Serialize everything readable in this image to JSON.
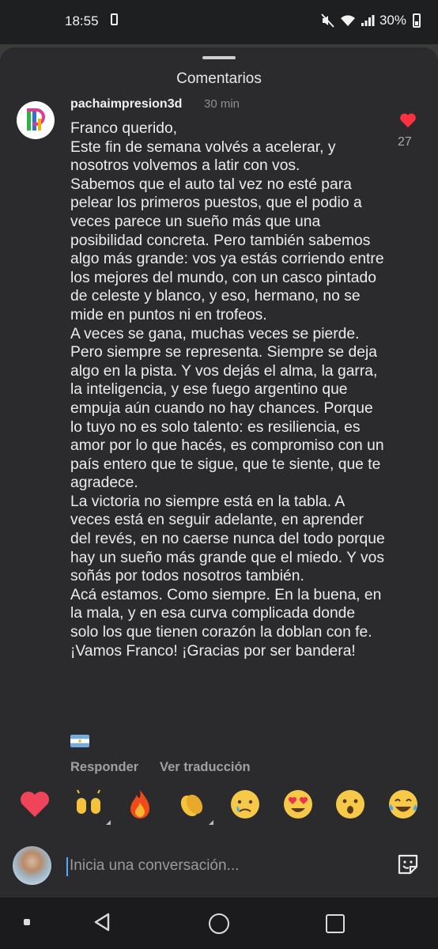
{
  "status_bar": {
    "time": "18:55",
    "battery": "30%",
    "icons": [
      "sim-card-icon",
      "mute-icon",
      "wifi-icon",
      "signal-icon",
      "battery-icon"
    ]
  },
  "sheet": {
    "title": "Comentarios"
  },
  "comment": {
    "username": "pachaimpresion3d",
    "time_ago": "30 min",
    "text": "Franco querido,\nEste fin de semana volvés a acelerar, y nosotros volvemos a latir con vos.\nSabemos que el auto tal vez no esté para pelear los primeros puestos, que el podio a veces parece un sueño más que una posibilidad concreta. Pero también sabemos algo más grande: vos ya estás corriendo entre los mejores del mundo, con un casco pintado de celeste y blanco, y eso, hermano, no se mide en puntos ni en trofeos.\nA veces se gana, muchas veces se pierde. Pero siempre se representa. Siempre se deja algo en la pista. Y vos dejás el alma, la garra, la inteligencia, y ese fuego argentino que empuja aún cuando no hay chances. Porque lo tuyo no es solo talento: es resiliencia, es amor por lo que hacés, es compromiso con un país entero que te sigue, que te siente, que te agradece.\nLa victoria no siempre está en la tabla. A veces está en seguir adelante, en aprender del revés, en no caerse nunca del todo porque hay un sueño más grande que el miedo. Y vos soñás por todos nosotros también.\nAcá estamos. Como siempre. En la buena, en la mala, y en esa curva complicada donde solo los que tienen corazón la doblan con fe.\n¡Vamos Franco! ¡Gracias por ser bandera!",
    "flag_emoji": "argentina-flag-icon",
    "likes": "27",
    "reply_label": "Responder",
    "translate_label": "Ver traducción"
  },
  "reactions": [
    {
      "name": "red-heart-emoji"
    },
    {
      "name": "raising-hands-emoji"
    },
    {
      "name": "fire-emoji"
    },
    {
      "name": "clapping-hands-emoji"
    },
    {
      "name": "crying-face-emoji"
    },
    {
      "name": "heart-eyes-emoji"
    },
    {
      "name": "surprised-face-emoji"
    },
    {
      "name": "tears-of-joy-emoji"
    }
  ],
  "composer": {
    "placeholder": "Inicia una conversación..."
  },
  "colors": {
    "sheet_bg": "#2b2b2d",
    "like_red": "#ff3040",
    "cursor_blue": "#5aa6ff"
  }
}
